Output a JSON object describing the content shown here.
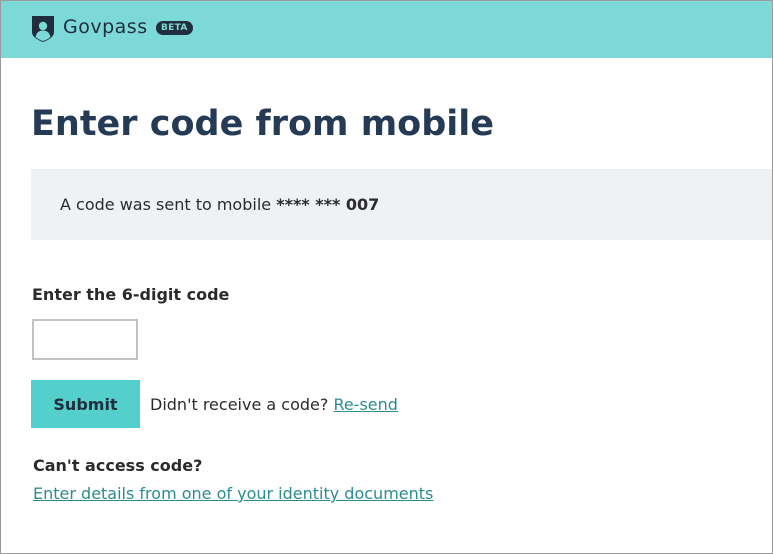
{
  "header": {
    "brand": "Govpass",
    "badge": "BETA",
    "logo_icon": "shield-person-icon",
    "background_color": "#7dd8d8"
  },
  "page": {
    "title": "Enter code from mobile"
  },
  "notice": {
    "text_prefix": "A code was sent to mobile ",
    "masked_number": "**** *** 007"
  },
  "form": {
    "code_label": "Enter the 6-digit code",
    "code_value": "",
    "submit_label": "Submit",
    "resend_prompt": "Didn't receive a code? ",
    "resend_link": "Re-send"
  },
  "alternate": {
    "heading": "Can't access code?",
    "link_text": "Enter details from one of your identity documents"
  },
  "colors": {
    "accent": "#55cfcc",
    "title": "#243a55",
    "link": "#2c8c8f",
    "notice_bg": "#eff2f5"
  }
}
